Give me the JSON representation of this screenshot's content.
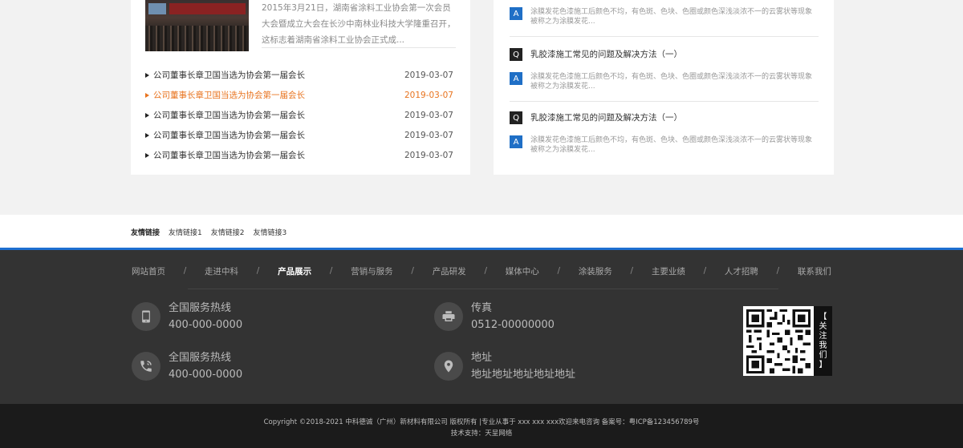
{
  "news": {
    "summary": "2015年3月21日，湖南省涂料工业协会第一次会员大会暨成立大会在长沙中南林业科技大学隆重召开，这标志着湖南省涂料工业协会正式成...",
    "items": [
      {
        "title": "公司董事长章卫国当选为协会第一届会长",
        "date": "2019-03-07",
        "active": false
      },
      {
        "title": "公司董事长章卫国当选为协会第一届会长",
        "date": "2019-03-07",
        "active": true
      },
      {
        "title": "公司董事长章卫国当选为协会第一届会长",
        "date": "2019-03-07",
        "active": false
      },
      {
        "title": "公司董事长章卫国当选为协会第一届会长",
        "date": "2019-03-07",
        "active": false
      },
      {
        "title": "公司董事长章卫国当选为协会第一届会长",
        "date": "2019-03-07",
        "active": false
      }
    ],
    "accent_color": "#e8731e"
  },
  "qa": {
    "q_badge": "Q",
    "a_badge": "A",
    "top_answer": "涂膜发花色漆施工后颜色不均，有色斑、色块、色圈或颜色深浅淡浓不一的云雾状等现象被称之为涂膜发花...",
    "items": [
      {
        "question": "乳胶漆施工常见的问题及解决方法（一）",
        "answer": "涂膜发花色漆施工后颜色不均，有色斑、色块、色圈或颜色深浅淡浓不一的云雾状等现象被称之为涂膜发花..."
      },
      {
        "question": "乳胶漆施工常见的问题及解决方法（一）",
        "answer": "涂膜发花色漆施工后颜色不均，有色斑、色块、色圈或颜色深浅淡浓不一的云雾状等现象被称之为涂膜发花..."
      }
    ],
    "a_color": "#1f6fc6"
  },
  "links": {
    "label": "友情链接",
    "items": [
      "友情链接1",
      "友情链接2",
      "友情链接3"
    ]
  },
  "footer": {
    "nav": [
      "网站首页",
      "走进中科",
      "产品展示",
      "营销与服务",
      "产品研发",
      "媒体中心",
      "涂装服务",
      "主要业绩",
      "人才招聘",
      "联系我们"
    ],
    "nav_current": "产品展示",
    "nav_separator": "/",
    "contacts": [
      {
        "icon": "mobile-phone-icon",
        "title": "全国服务热线",
        "value": "400-000-0000"
      },
      {
        "icon": "printer-icon",
        "title": "传真",
        "value": "0512-00000000"
      },
      {
        "icon": "phone-call-icon",
        "title": "全国服务热线",
        "value": "400-000-0000"
      },
      {
        "icon": "location-pin-icon",
        "title": "地址",
        "value": "地址地址地址地址地址"
      }
    ],
    "qr_label": "【关注我们】",
    "copyright": "Copyright ©2018-2021 中科德诚（广州）新材料有限公司 版权所有 |专业从事于 xxx xxx xxx欢迎来电咨询 备案号：粤ICP备123456789号",
    "support": "技术支持：天呈网络"
  },
  "colors": {
    "footer_bg": "#333333",
    "copyright_bg": "#1b1b1b",
    "accent_blue": "#1e6fd0"
  }
}
